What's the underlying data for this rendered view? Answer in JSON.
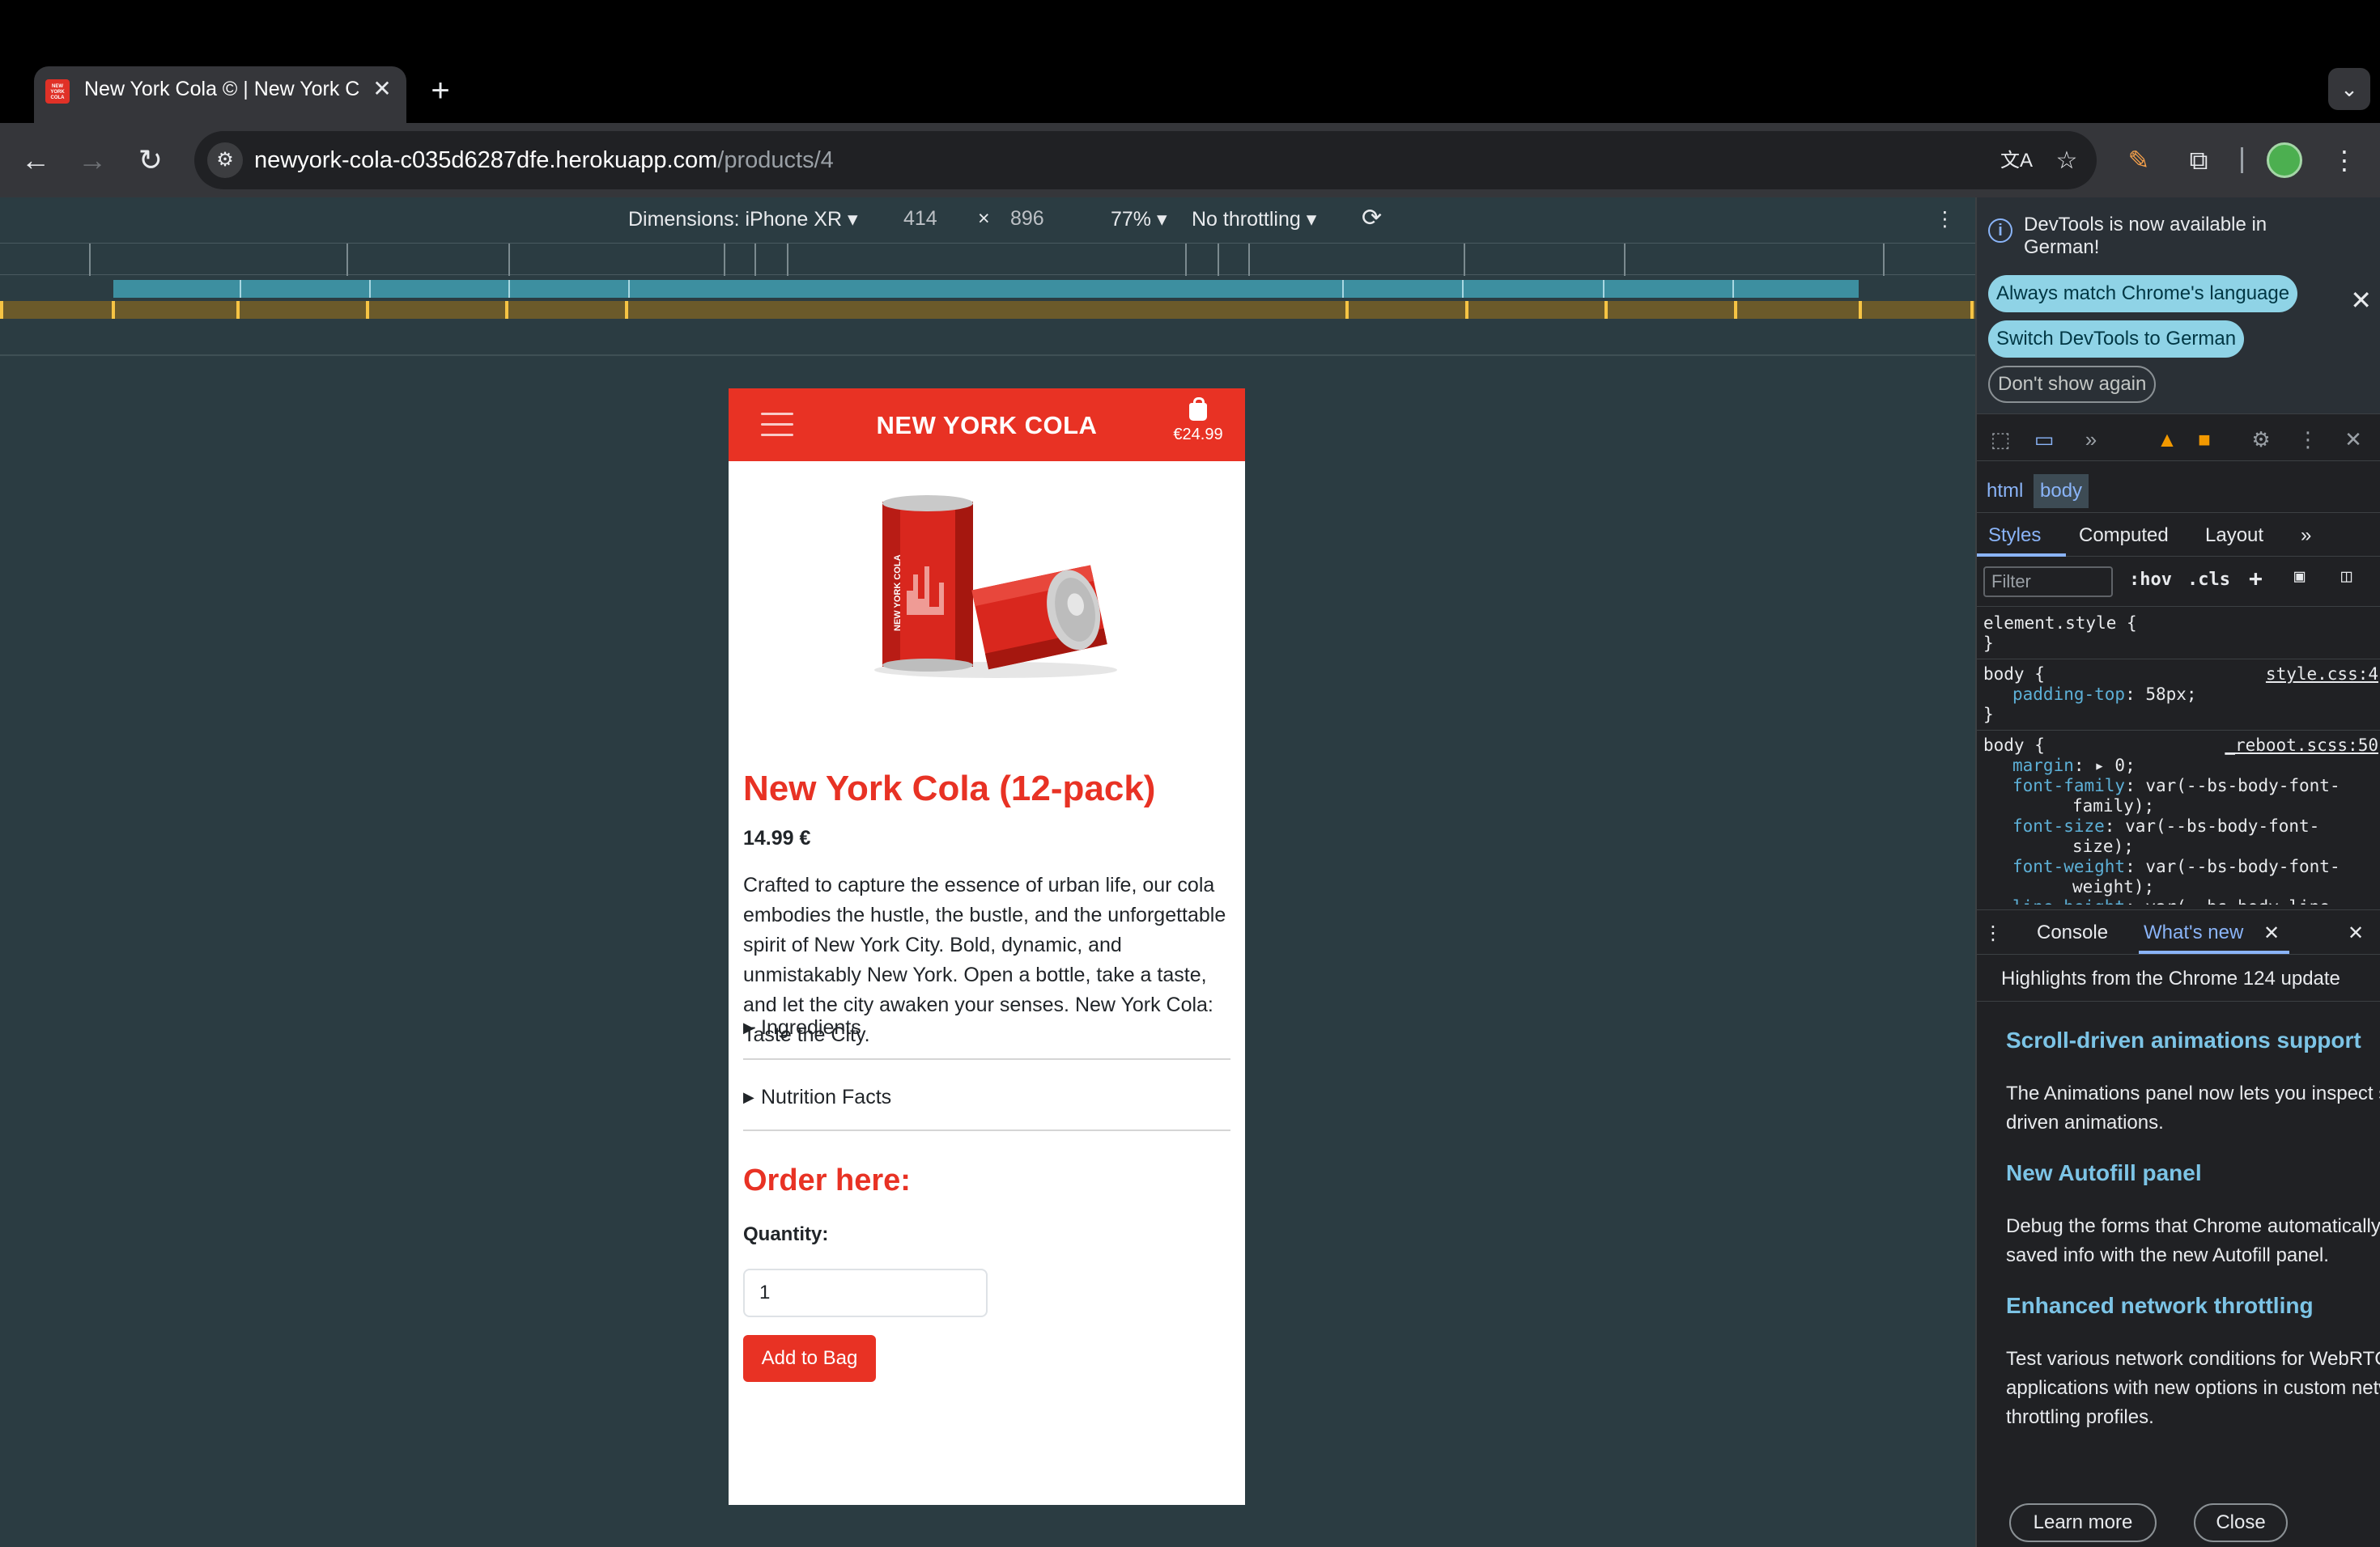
{
  "browser": {
    "tab_title": "New York Cola © | New York Cola",
    "favicon_text": "NEW YORK COLA",
    "url_host": "newyork-cola-c035d6287dfe.herokuapp.com",
    "url_path": "/products/4"
  },
  "device_toolbar": {
    "dimensions_label": "Dimensions: iPhone XR",
    "width": "414",
    "times": "×",
    "height": "896",
    "zoom": "77%",
    "throttling": "No throttling"
  },
  "page": {
    "brand": "NEW YORK COLA",
    "bag_total": "€24.99",
    "product_title": "New York Cola (12-pack)",
    "price": "14.99 €",
    "description": "Crafted to capture the essence of urban life, our cola embodies the hustle, the bustle, and the unforgettable spirit of New York City. Bold, dynamic, and unmistakably New York. Open a bottle, take a taste, and let the city awaken your senses. New York Cola: Taste the City.",
    "ingredients_label": "Ingredients",
    "nutrition_label": "Nutrition Facts",
    "order_title": "Order here:",
    "quantity_label": "Quantity:",
    "quantity_value": "1",
    "add_button": "Add to Bag",
    "can_label": "NEW YORK COLA"
  },
  "devtools": {
    "infobar_message": "DevTools is now available in German!",
    "always_match": "Always match Chrome's language",
    "switch_german": "Switch DevTools to German",
    "dont_show": "Don't show again",
    "crumb_html": "html",
    "crumb_body": "body",
    "tab_styles": "Styles",
    "tab_computed": "Computed",
    "tab_layout": "Layout",
    "filter_placeholder": "Filter",
    "hov": ":hov",
    "cls": ".cls",
    "styles": {
      "r1_selector": "element.style {",
      "r1_close": "}",
      "r2_selector": "body {",
      "r2_source": "style.css:4",
      "r2_prop": "padding-top",
      "r2_val": ": 58px;",
      "r2_close": "}",
      "r3_selector": "body {",
      "r3_source": "_reboot.scss:50",
      "r3_p1": "margin",
      "r3_v1": ": ▸ 0;",
      "r3_p2": "font-family",
      "r3_v2": ": var(--bs-body-font-",
      "r3_v2b": "family);",
      "r3_p3": "font-size",
      "r3_v3": ": var(--bs-body-font-",
      "r3_v3b": "size);",
      "r3_p4": "font-weight",
      "r3_v4": ": var(--bs-body-font-",
      "r3_v4b": "weight);",
      "r3_p5": "line-height",
      "r3_v5": ": var(--bs-body-line-"
    },
    "drawer_console": "Console",
    "drawer_whatsnew": "What's new",
    "whatsnew_header": "Highlights from the Chrome 124 update",
    "h1": "Scroll-driven animations support",
    "p1a": "The Animations panel now lets you inspect scroll-",
    "p1b": "driven animations.",
    "h2": "New Autofill panel",
    "p2a": "Debug the forms that Chrome automatically fills with",
    "p2b": "saved info with the new Autofill panel.",
    "h3": "Enhanced network throttling",
    "p3a": "Test various network conditions for WebRTC",
    "p3b": "applications with new options in custom network",
    "p3c": "throttling profiles.",
    "learn_more": "Learn more",
    "close": "Close"
  },
  "colors": {
    "brand_red": "#e83224",
    "devtools_accent": "#8ab4f8",
    "viewport_bg": "#2b3c42"
  }
}
